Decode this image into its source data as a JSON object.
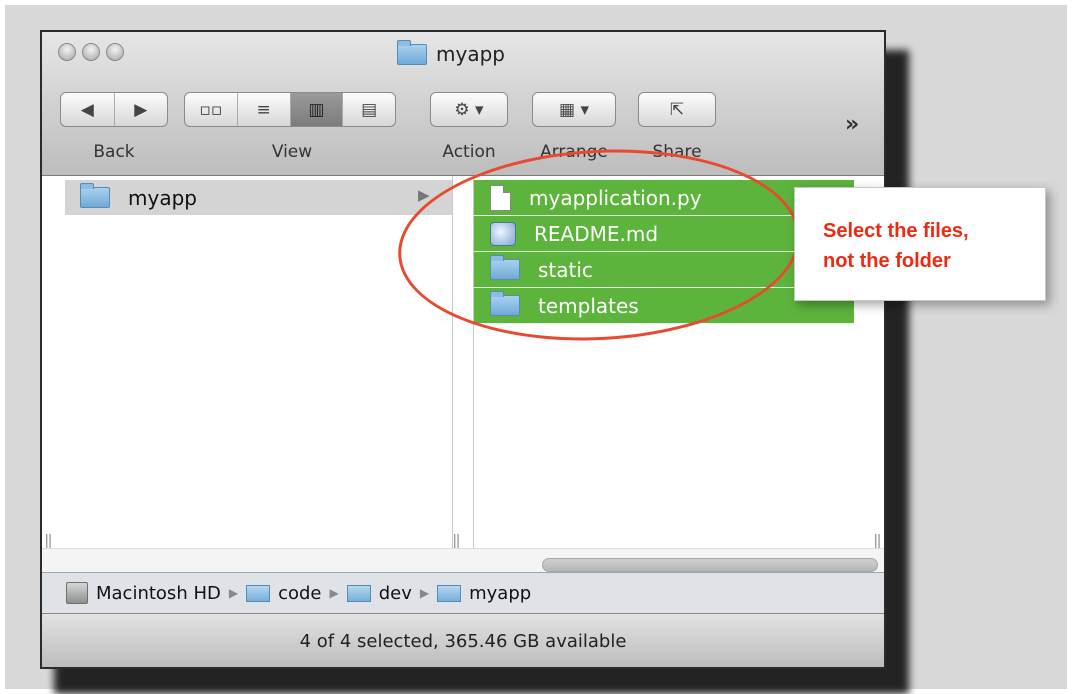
{
  "window": {
    "title": "myapp"
  },
  "toolbar": {
    "back_label": "Back",
    "view_label": "View",
    "action_label": "Action",
    "arrange_label": "Arrange",
    "share_label": "Share",
    "overflow_glyph": "»"
  },
  "columns": {
    "left": [
      {
        "name": "myapp",
        "type": "folder",
        "highlighted": true
      }
    ],
    "right": [
      {
        "name": "myapplication.py",
        "type": "file",
        "selected": true
      },
      {
        "name": "README.md",
        "type": "markdown",
        "selected": true
      },
      {
        "name": "static",
        "type": "folder",
        "selected": true
      },
      {
        "name": "templates",
        "type": "folder",
        "selected": true
      }
    ]
  },
  "pathbar": {
    "items": [
      "Macintosh HD",
      "code",
      "dev",
      "myapp"
    ]
  },
  "status": {
    "text": "4 of 4 selected, 365.46 GB available"
  },
  "annotation": {
    "line1": "Select the files,",
    "line2": "not the folder",
    "color": "#ee2a12"
  },
  "colors": {
    "selection": "#5cb43c",
    "circle": "#e84a2f"
  }
}
